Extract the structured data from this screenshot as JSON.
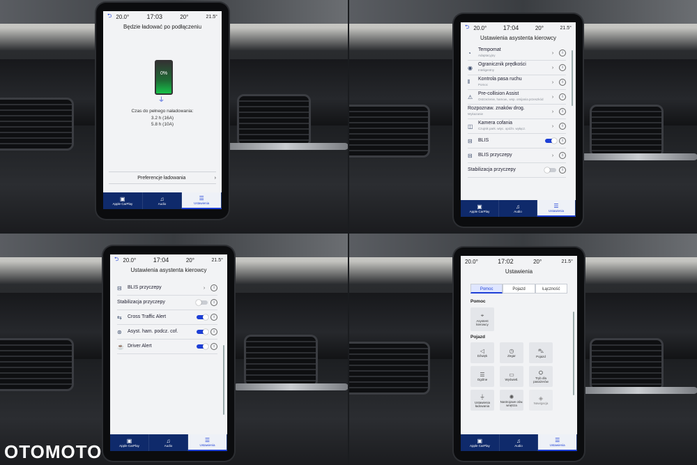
{
  "watermark": "OTOMOTO",
  "panel1": {
    "temp_left": "20.0°",
    "clock": "17:03",
    "temp_mid": "20°",
    "temp_out": "21.5°",
    "title": "Będzie ładować po podłączeniu",
    "battery_pct": "0%",
    "time_label": "Czas do pełnego naładowania:",
    "time_16a": "3.2 h (16A)",
    "time_10a": "5.8 h (10A)",
    "pref_button": "Preferencje ładowania"
  },
  "panel2": {
    "temp_left": "20.0°",
    "clock": "17:04",
    "temp_mid": "20°",
    "temp_out": "21.5°",
    "title": "Ustawienia asystenta kierowcy",
    "rows": [
      {
        "label": "Tempomat",
        "sub": "Adaptacyjny"
      },
      {
        "label": "Ogranicznik prędkości",
        "sub": "Inteligentny"
      },
      {
        "label": "Kontrola pasa ruchu",
        "sub": "Pomoc"
      },
      {
        "label": "Pre-collision Assist",
        "sub": "Ostrzeżenie, hamow., wsp. omijania przeszkód"
      },
      {
        "label": "Rozpoznaw. znaków drog.",
        "sub": "Wykazanie"
      },
      {
        "label": "Kamera cofania",
        "sub": "Czujnik park. wtyc. opóźn. wyłącz."
      },
      {
        "label": "BLIS",
        "sub": ""
      },
      {
        "label": "BLIS przyczepy",
        "sub": ""
      },
      {
        "label": "Stabilizacja przyczepy",
        "sub": ""
      }
    ]
  },
  "panel3": {
    "temp_left": "20.0°",
    "clock": "17:04",
    "temp_mid": "20°",
    "temp_out": "21.5°",
    "title": "Ustawienia asystenta kierowcy",
    "rows": [
      {
        "label": "BLIS przyczepy"
      },
      {
        "label": "Stabilizacja przyczepy"
      },
      {
        "label": "Cross Traffic Alert"
      },
      {
        "label": "Asyst. ham. podcz. cof."
      },
      {
        "label": "Driver Alert"
      }
    ]
  },
  "panel4": {
    "temp_left": "20.0°",
    "clock": "17:02",
    "temp_mid": "20°",
    "temp_out": "21.5°",
    "title": "Ustawienia",
    "tabs": [
      "Pomoc",
      "Pojazd",
      "Łączność"
    ],
    "section_help": "Pomoc",
    "help_tile": "Asystent kierowcy",
    "section_vehicle": "Pojazd",
    "tiles": [
      "Dźwięk",
      "Zegar",
      "Pojazd",
      "Ogólne",
      "Wyświetl.",
      "Tryb dla pasażerów",
      "Ustawienia ładowania",
      "Nastrojowe ośw. wnętrza",
      "Nawigacja"
    ]
  },
  "nav": {
    "apple": "Apple CarPlay",
    "audio": "Audio",
    "settings": "Ustawienia"
  }
}
